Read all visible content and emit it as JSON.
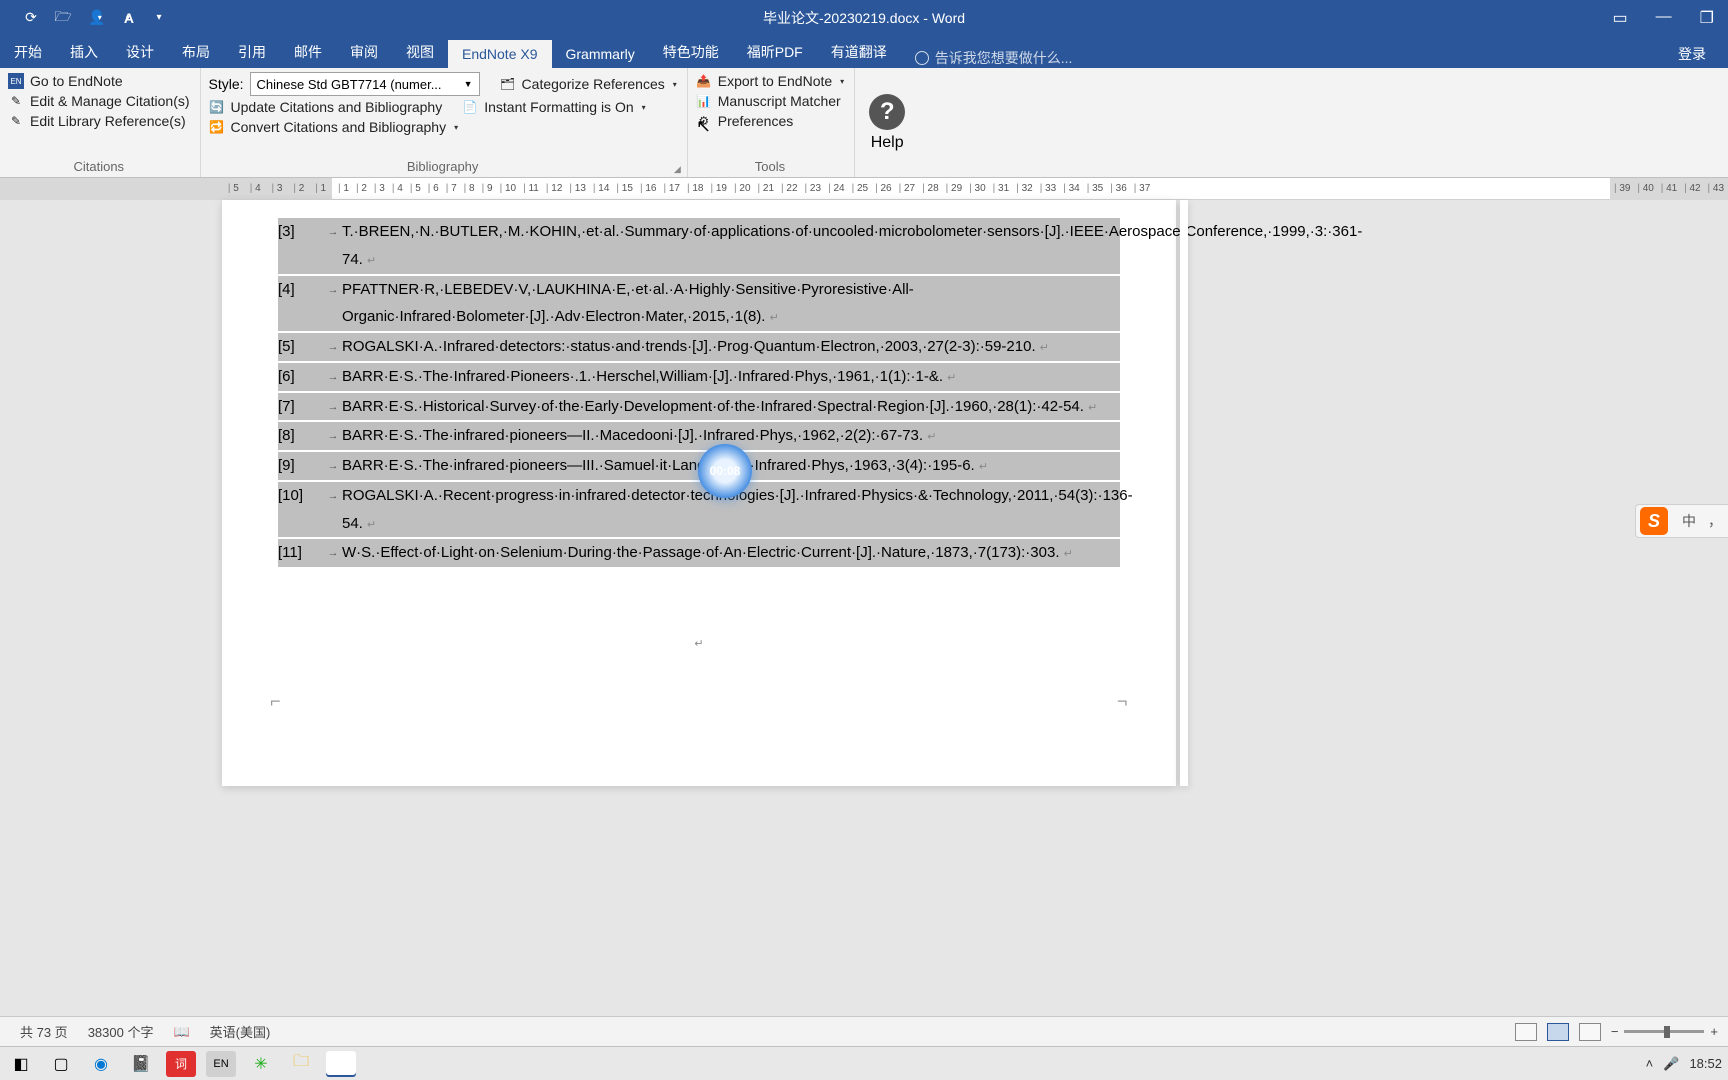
{
  "title": "毕业论文-20230219.docx - Word",
  "login": "登录",
  "tabs": {
    "items": [
      "开始",
      "插入",
      "设计",
      "布局",
      "引用",
      "邮件",
      "审阅",
      "视图",
      "EndNote X9",
      "Grammarly",
      "特色功能",
      "福昕PDF",
      "有道翻译"
    ],
    "active_index": 8,
    "tellme": "告诉我您想要做什么..."
  },
  "ribbon": {
    "citations": {
      "label": "Citations",
      "goto": "Go to EndNote",
      "edit_cit": "Edit & Manage Citation(s)",
      "edit_lib": "Edit Library Reference(s)"
    },
    "bibliography": {
      "label": "Bibliography",
      "style_label": "Style:",
      "style_value": "Chinese Std GBT7714 (numer...",
      "update": "Update Citations and Bibliography",
      "convert": "Convert Citations and Bibliography",
      "categorize": "Categorize References",
      "instant": "Instant Formatting is On"
    },
    "tools": {
      "label": "Tools",
      "export": "Export to EndNote",
      "match": "Manuscript Matcher",
      "prefs": "Preferences"
    },
    "help": "Help"
  },
  "timer": "00:08",
  "ime": {
    "lang": "中",
    "punct": "，"
  },
  "refs": [
    {
      "n": "[3]",
      "t": "T.·BREEN,·N.·BUTLER,·M.·KOHIN,·et·al.·Summary·of·applications·of·uncooled·microbolometer·sensors·[J].·IEEE·Aerospace·Conference,·1999,·3:·361-74."
    },
    {
      "n": "[4]",
      "t": "PFATTNER·R,·LEBEDEV·V,·LAUKHINA·E,·et·al.·A·Highly·Sensitive·Pyroresistive·All-Organic·Infrared·Bolometer·[J].·Adv·Electron·Mater,·2015,·1(8)."
    },
    {
      "n": "[5]",
      "t": "ROGALSKI·A.·Infrared·detectors:·status·and·trends·[J].·Prog·Quantum·Electron,·2003,·27(2-3):·59-210."
    },
    {
      "n": "[6]",
      "t": "BARR·E·S.·The·Infrared·Pioneers·.1.·Herschel,William·[J].·Infrared·Phys,·1961,·1(1):·1-&."
    },
    {
      "n": "[7]",
      "t": "BARR·E·S.·Historical·Survey·of·the·Early·Development·of·the·Infrared·Spectral·Region·[J].·1960,·28(1):·42-54."
    },
    {
      "n": "[8]",
      "t": "BARR·E·S.·The·infrared·pioneers—II.·Macedo​​​​​​​​oni·[J].·Infrared·Phys,·1962,·2(2):·67-73."
    },
    {
      "n": "[9]",
      "t": "BARR·E·S.·The·infrared·pioneers—III.·Samuel·​​​​​​​​​it·Langley·[J].·Infrared·Phys,·1963,·3(4):·195-6."
    },
    {
      "n": "[10]",
      "t": "ROGALSKI·A.·Recent·progress·in·infrared·detector·technologies·[J].·Infrared·Physics·&·Technology,·2011,·54(3):·136-54."
    },
    {
      "n": "[11]",
      "t": "W·S.·Effect·of·Light·on·Selenium·During·the·Passage·of·An·Electric·Current·[J].·Nature,·1873,·7(173):·303."
    }
  ],
  "status": {
    "pages": "共 73 页",
    "words": "38300 个字",
    "lang": "英语(美国)"
  },
  "tray": {
    "clock": "18:52"
  },
  "ruler": {
    "left": [
      "5",
      "4",
      "3",
      "2",
      "1"
    ],
    "right": [
      "1",
      "2",
      "3",
      "4",
      "5",
      "6",
      "7",
      "8",
      "9",
      "10",
      "11",
      "12",
      "13",
      "14",
      "15",
      "16",
      "17",
      "18",
      "19",
      "20",
      "21",
      "22",
      "23",
      "24",
      "25",
      "26",
      "27",
      "28",
      "29",
      "30",
      "31",
      "32",
      "33",
      "34",
      "35",
      "36",
      "37"
    ],
    "far": [
      "39",
      "40",
      "41",
      "42",
      "43"
    ]
  }
}
